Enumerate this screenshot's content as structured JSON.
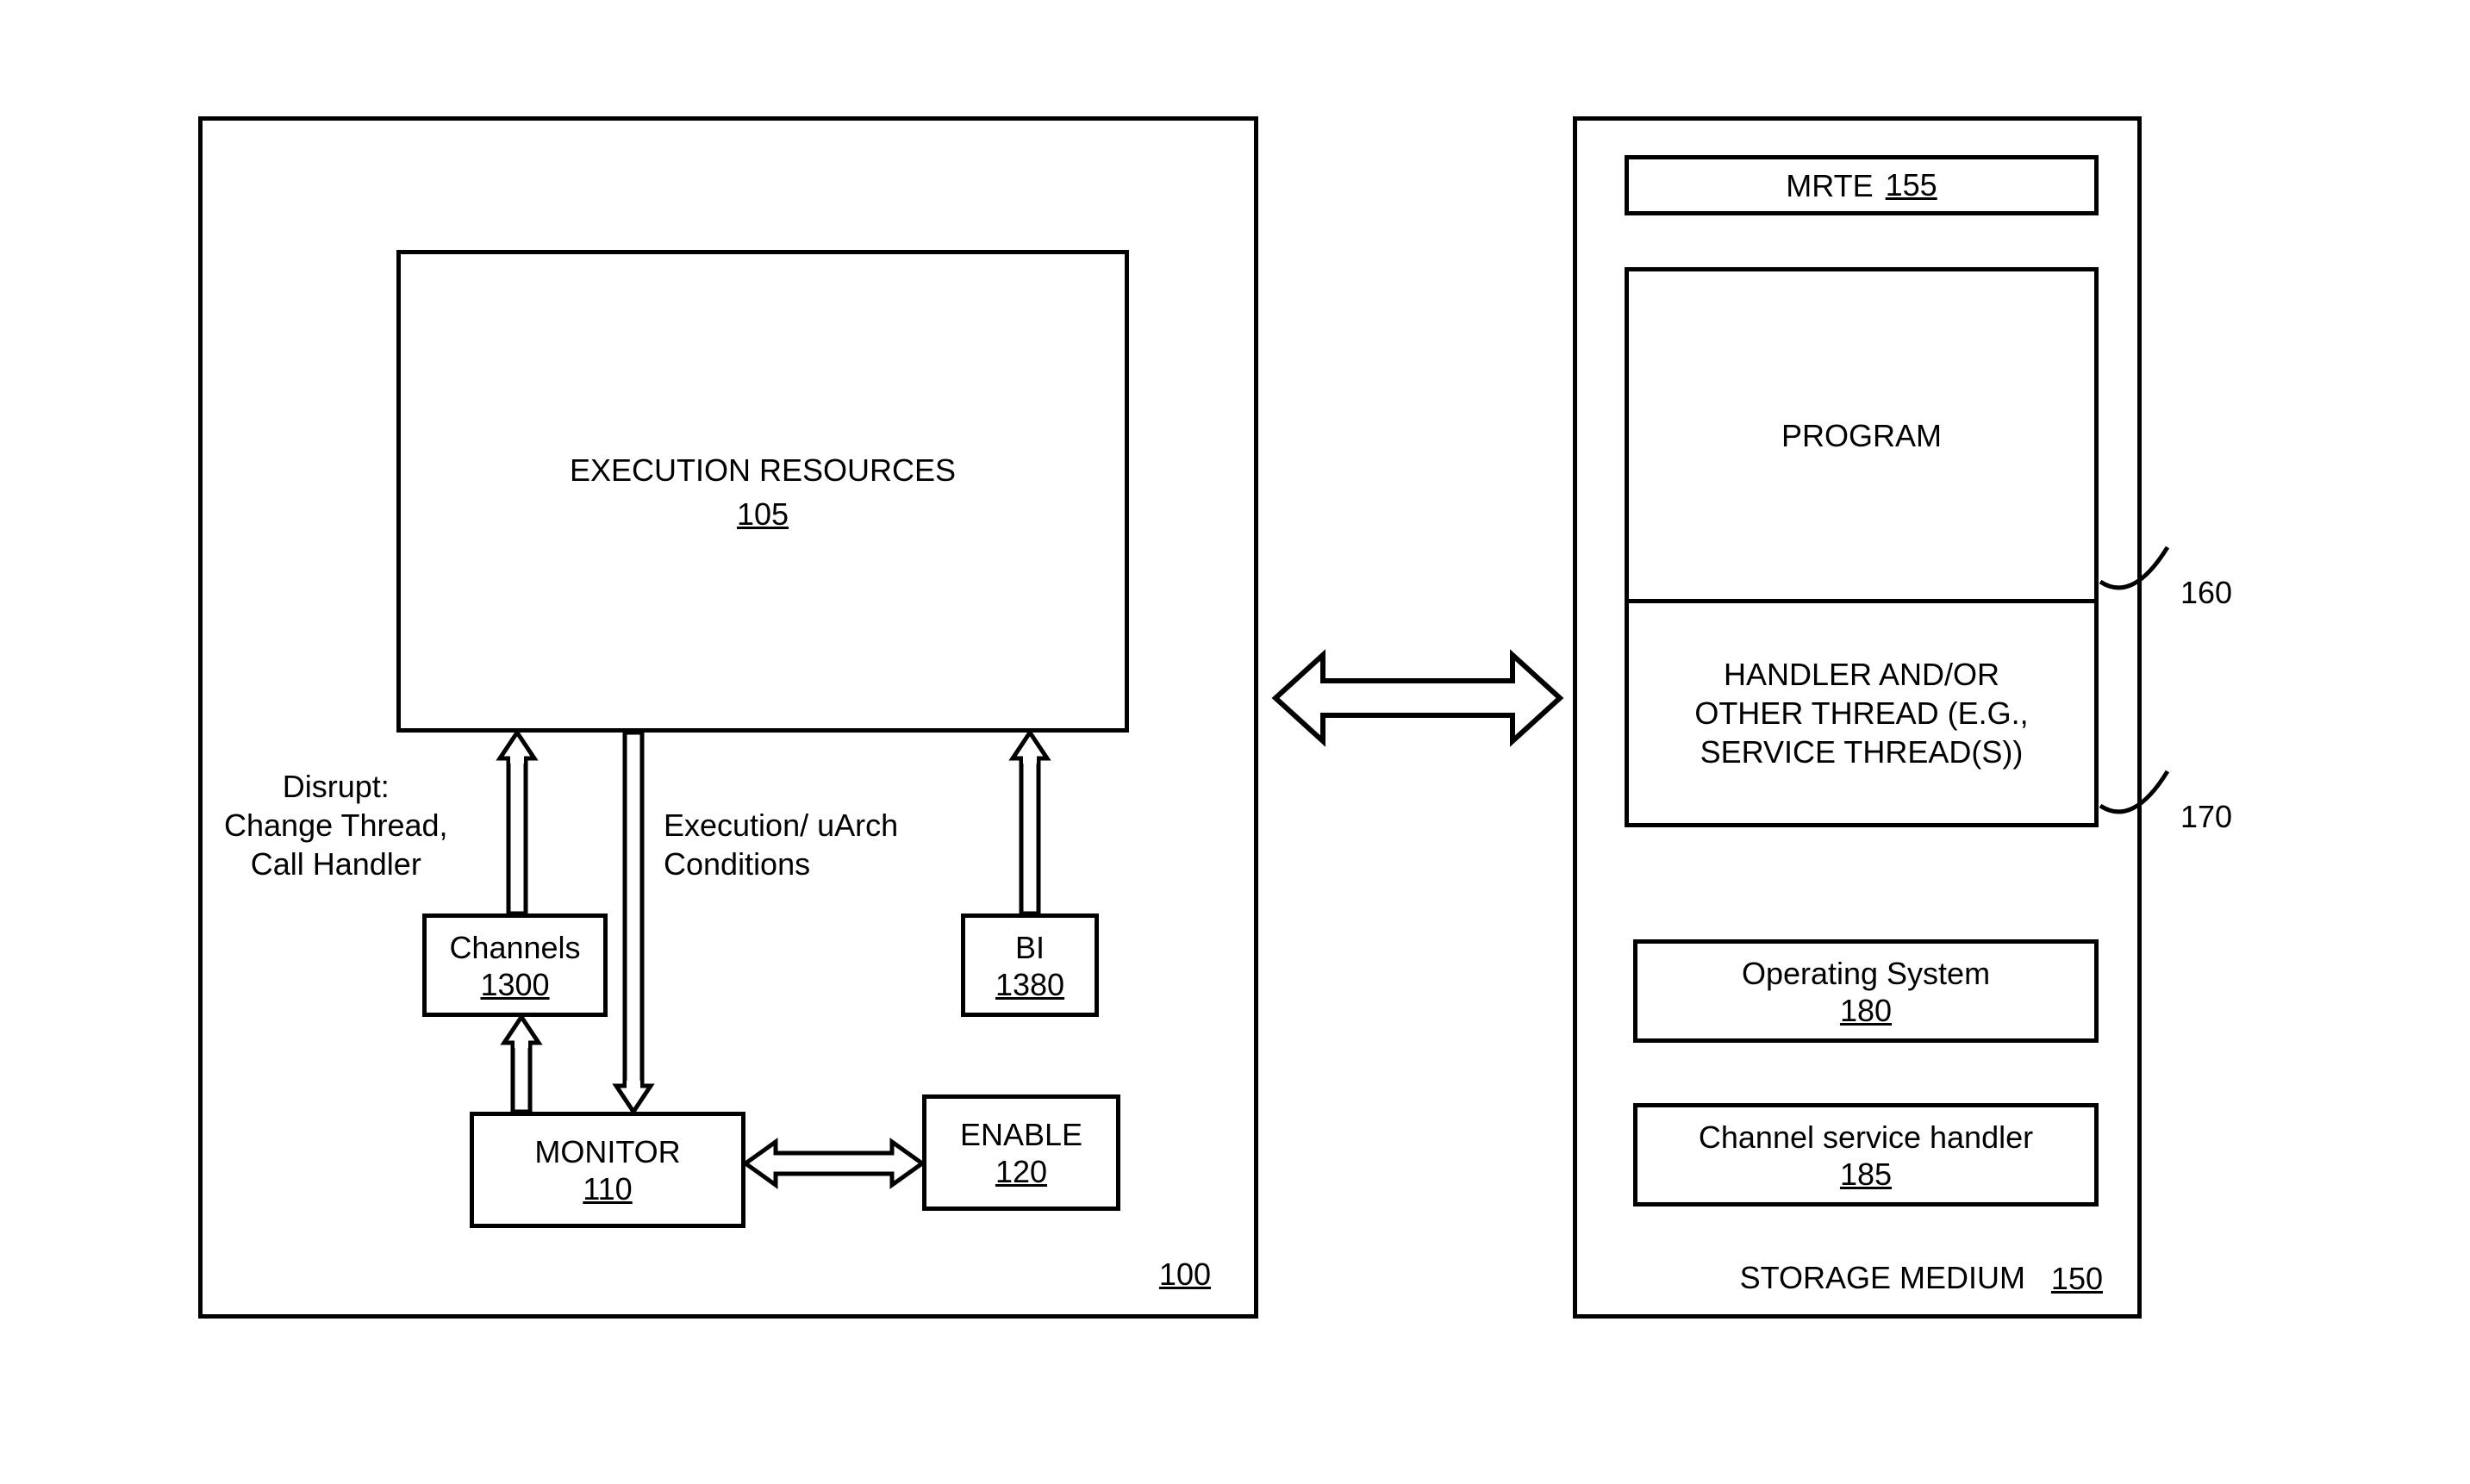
{
  "left": {
    "ref": "100",
    "exec": {
      "title": "EXECUTION RESOURCES",
      "ref": "105"
    },
    "disrupt": {
      "line1": "Disrupt:",
      "line2": "Change Thread,",
      "line3": "Call Handler"
    },
    "cond": {
      "line1": "Execution/ uArch",
      "line2": "Conditions"
    },
    "channels": {
      "title": "Channels",
      "ref": "1300"
    },
    "bi": {
      "title": "BI",
      "ref": "1380"
    },
    "monitor": {
      "title": "MONITOR",
      "ref": "110"
    },
    "enable": {
      "title": "ENABLE",
      "ref": "120"
    }
  },
  "right": {
    "title": "STORAGE MEDIUM",
    "ref": "150",
    "mrte": {
      "title": "MRTE",
      "ref": "155"
    },
    "program": {
      "title": "PROGRAM"
    },
    "handler": {
      "line1": "HANDLER AND/OR",
      "line2": "OTHER THREAD (E.G.,",
      "line3": "SERVICE THREAD(S))"
    },
    "callout160": "160",
    "callout170": "170",
    "os": {
      "title": "Operating System",
      "ref": "180"
    },
    "csh": {
      "title": "Channel service handler",
      "ref": "185"
    }
  }
}
